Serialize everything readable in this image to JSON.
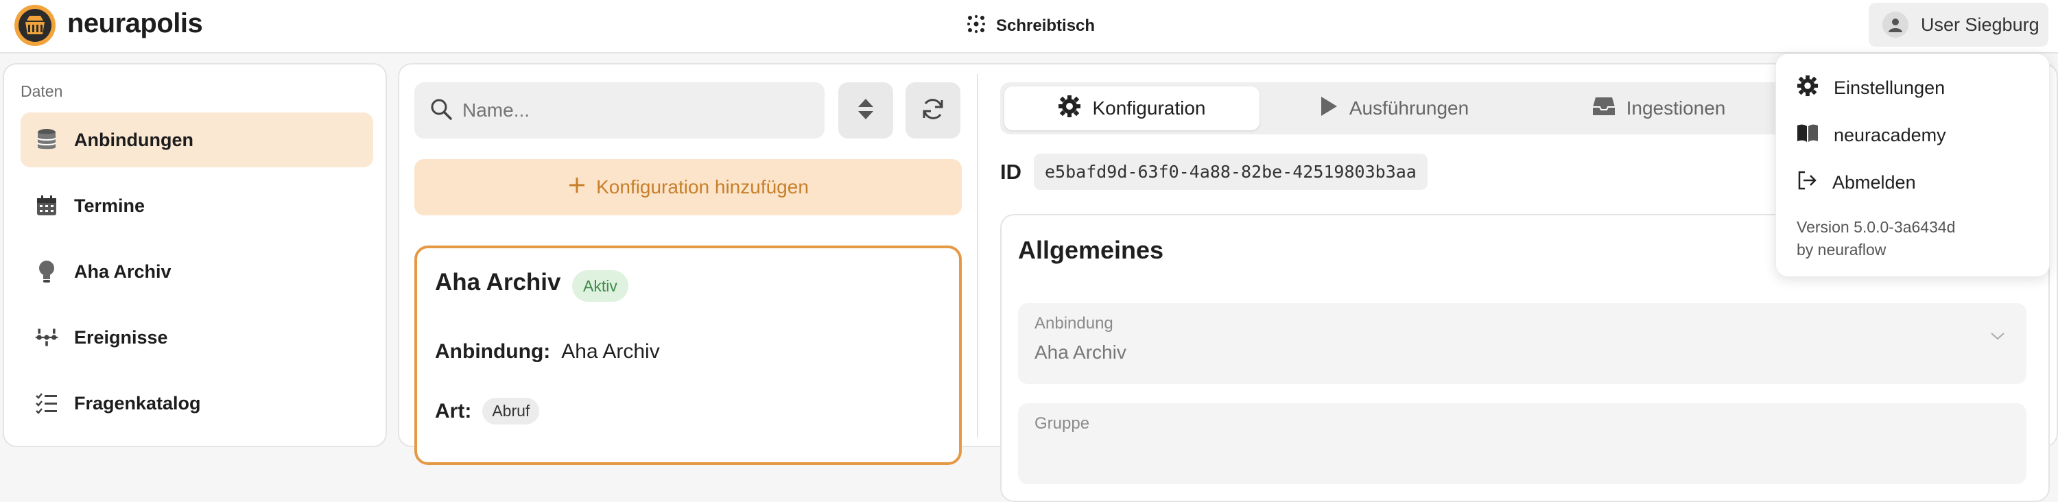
{
  "header": {
    "brand": "neurapolis",
    "center_label": "Schreibtisch",
    "user_label": "User Siegburg"
  },
  "sidebar": {
    "section_label": "Daten",
    "items": [
      {
        "label": "Anbindungen",
        "icon": "database-icon",
        "active": true
      },
      {
        "label": "Termine",
        "icon": "calendar-icon",
        "active": false
      },
      {
        "label": "Aha Archiv",
        "icon": "lightbulb-icon",
        "active": false
      },
      {
        "label": "Ereignisse",
        "icon": "timeline-icon",
        "active": false
      },
      {
        "label": "Fragenkatalog",
        "icon": "checklist-icon",
        "active": false
      }
    ]
  },
  "list": {
    "search_placeholder": "Name...",
    "add_label": "Konfiguration hinzufügen",
    "card": {
      "title": "Aha Archiv",
      "status": "Aktiv",
      "binding_key": "Anbindung:",
      "binding_value": "Aha Archiv",
      "type_key": "Art:",
      "type_value": "Abruf"
    }
  },
  "detail": {
    "tabs": [
      {
        "label": "Konfiguration",
        "icon": "gear-icon",
        "active": true
      },
      {
        "label": "Ausführungen",
        "icon": "play-icon",
        "active": false
      },
      {
        "label": "Ingestionen",
        "icon": "inbox-icon",
        "active": false
      }
    ],
    "id_label": "ID",
    "id_value": "e5bafd9d-63f0-4a88-82be-42519803b3aa",
    "section_title": "Allgemeines",
    "fields": [
      {
        "label": "Anbindung",
        "value": "Aha Archiv"
      },
      {
        "label": "Gruppe",
        "value": ""
      }
    ]
  },
  "user_menu": {
    "items": [
      {
        "label": "Einstellungen",
        "icon": "gear-icon"
      },
      {
        "label": "neuracademy",
        "icon": "book-icon"
      },
      {
        "label": "Abmelden",
        "icon": "logout-icon"
      }
    ],
    "version_line1": "Version 5.0.0-3a6434d",
    "version_line2": "by neuraflow"
  },
  "colors": {
    "accent": "#e49a45",
    "accent_bg": "#fbe8d2",
    "success_bg": "#dff1df",
    "success_text": "#3f8a49"
  }
}
